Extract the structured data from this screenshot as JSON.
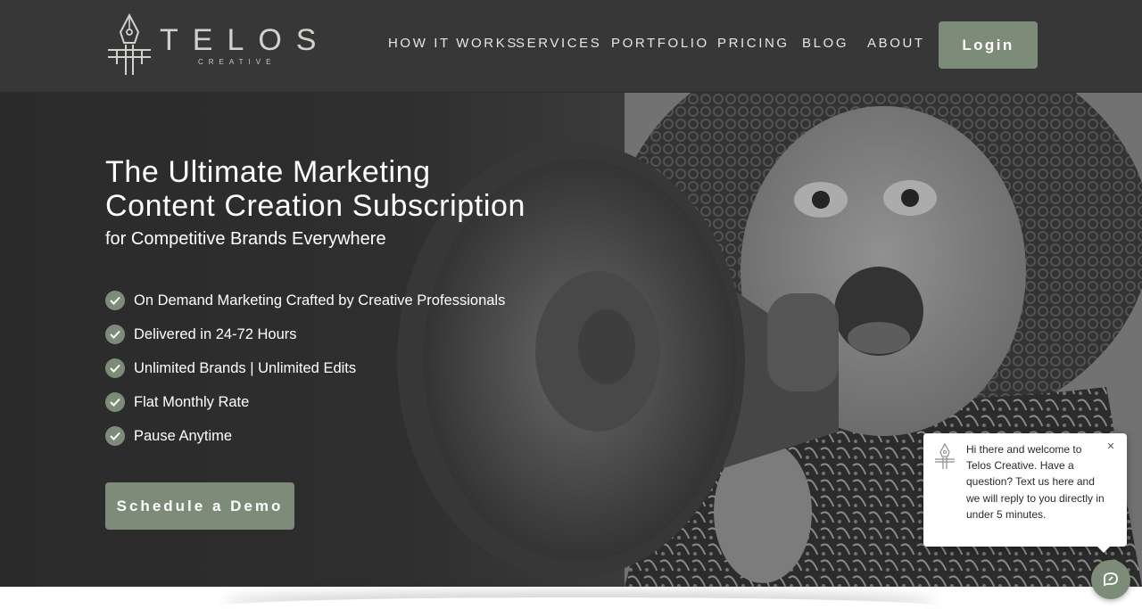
{
  "brand": {
    "name": "TELOS",
    "tagline": "CREATIVE",
    "accent_color": "#7d8c79",
    "logo_icon": "pen-nib-icon"
  },
  "nav": {
    "items": [
      {
        "label": "HOW IT WORKS"
      },
      {
        "label": "SERVICES"
      },
      {
        "label": "PORTFOLIO"
      },
      {
        "label": "PRICING"
      },
      {
        "label": "BLOG"
      },
      {
        "label": "ABOUT"
      }
    ],
    "login_label": "Login"
  },
  "hero": {
    "title": "The Ultimate Marketing Content Creation Subscription",
    "subtitle": "for Competitive Brands Everywhere",
    "features": [
      "On Demand Marketing Crafted by Creative Professionals",
      "Delivered in 24-72 Hours",
      "Unlimited Brands | Unlimited Edits",
      "Flat Monthly Rate",
      "Pause Anytime"
    ],
    "feature_icon": "check-circle-icon",
    "cta_label": "Schedule a Demo",
    "image": "woman-with-megaphone-photo"
  },
  "chat": {
    "message": "Hi there and welcome to Telos Creative. Have a question? Text us here and we will reply to you directly in under 5 minutes.",
    "close_icon": "close-icon",
    "launcher_icon": "chat-bubble-icon"
  }
}
